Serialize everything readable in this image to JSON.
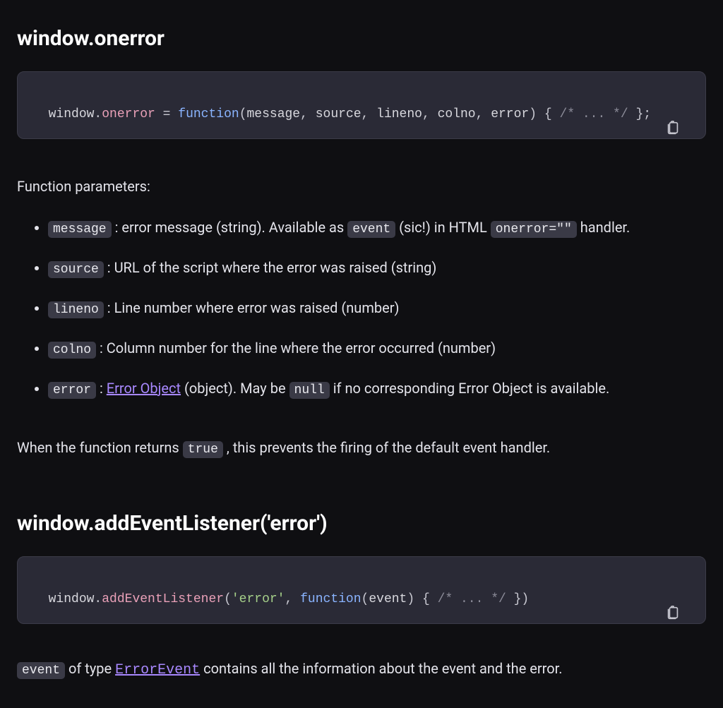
{
  "section1": {
    "heading": "window.onerror",
    "code": {
      "t1": "window",
      "t2": ".",
      "t3": "onerror",
      "t4": " = ",
      "t5": "function",
      "t6": "(",
      "p1": "message",
      "c1": ", ",
      "p2": "source",
      "c2": ", ",
      "p3": "lineno",
      "c3": ", ",
      "p4": "colno",
      "c4": ", ",
      "p5": "error",
      "t7": ")",
      "t8": " { ",
      "t9": "/* ... */",
      "t10": " };"
    }
  },
  "params_intro": "Function parameters:",
  "params": {
    "p1": {
      "name": "message",
      "before": " : error message (string). Available as ",
      "code1": "event",
      "mid": " (sic!) in HTML ",
      "code2": "onerror=\"\"",
      "after": " handler."
    },
    "p2": {
      "name": "source",
      "text": " : URL of the script where the error was raised (string)"
    },
    "p3": {
      "name": "lineno",
      "text": " : Line number where error was raised (number)"
    },
    "p4": {
      "name": "colno",
      "text": " : Column number for the line where the error occurred (number)"
    },
    "p5": {
      "name": "error",
      "before": " : ",
      "link": "Error Object",
      "mid": " (object). May be ",
      "code1": "null",
      "after": " if no corresponding Error Object is available."
    }
  },
  "return_note": {
    "before": "When the function returns ",
    "code": "true",
    "after": " , this prevents the firing of the default event handler."
  },
  "section2": {
    "heading": "window.addEventListener('error')",
    "code": {
      "t1": "window",
      "t2": ".",
      "t3": "addEventListener",
      "t4": "(",
      "t5": "'error'",
      "t6": ", ",
      "t7": "function",
      "t8": "(",
      "p1": "event",
      "t9": ")",
      "t10": " { ",
      "t11": "/* ... */",
      "t12": " })"
    }
  },
  "closing": {
    "code": "event",
    "mid": " of type ",
    "link": "ErrorEvent",
    "after": " contains all the information about the event and the error."
  }
}
